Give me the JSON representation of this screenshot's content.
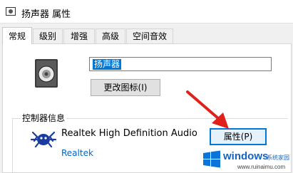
{
  "window": {
    "title": "扬声器 属性",
    "icon": "speaker-small-icon"
  },
  "tabs": [
    {
      "label": "常规",
      "active": true
    },
    {
      "label": "级别",
      "active": false
    },
    {
      "label": "增强",
      "active": false
    },
    {
      "label": "高级",
      "active": false
    },
    {
      "label": "空间音效",
      "active": false
    }
  ],
  "general": {
    "device_icon": "speaker-icon",
    "name_value": "扬声器",
    "change_icon_label": "更改图标(I)"
  },
  "controller": {
    "group_label": "控制器信息",
    "logo": "realtek-crab-logo",
    "device_name": "Realtek High Definition Audio",
    "vendor": "Realtek",
    "properties_label": "属性(P)"
  },
  "annotation": {
    "arrow_color": "#e0201b"
  },
  "watermark": {
    "main": "windows",
    "sub": "系统家园",
    "url": "www.ruinaimu.com"
  }
}
